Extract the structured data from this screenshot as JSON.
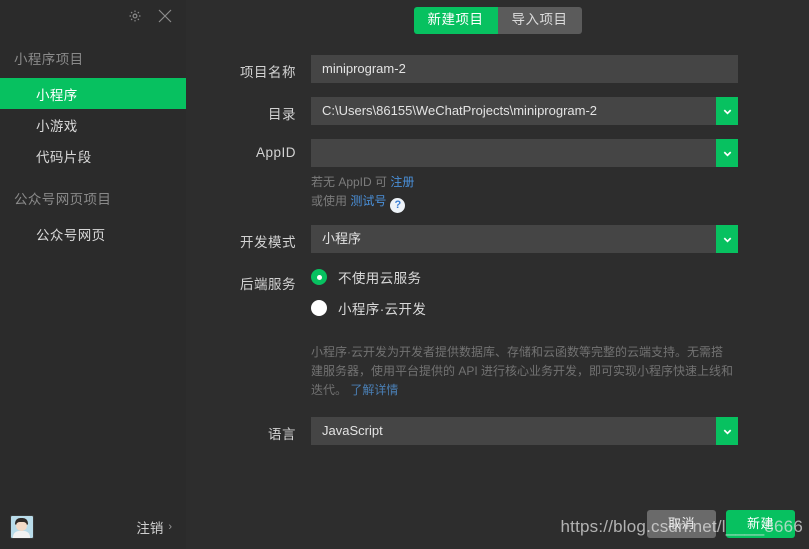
{
  "window": {
    "settings_icon": "gear-icon",
    "close_icon": "close-icon"
  },
  "sidebar": {
    "groups": [
      {
        "title": "小程序项目",
        "items": [
          {
            "label": "小程序",
            "active": true
          },
          {
            "label": "小游戏",
            "active": false
          },
          {
            "label": "代码片段",
            "active": false
          }
        ]
      },
      {
        "title": "公众号网页项目",
        "items": [
          {
            "label": "公众号网页",
            "active": false
          }
        ]
      }
    ],
    "footer": {
      "avatar_icon": "user-avatar",
      "logout_label": "注销",
      "logout_chevron": "›"
    }
  },
  "tabs": [
    {
      "label": "新建项目",
      "selected": true
    },
    {
      "label": "导入项目",
      "selected": false
    }
  ],
  "form": {
    "project_name": {
      "label": "项目名称",
      "value": "miniprogram-2"
    },
    "directory": {
      "label": "目录",
      "value": "C:\\Users\\86155\\WeChatProjects\\miniprogram-2"
    },
    "appid": {
      "label": "AppID",
      "value": ""
    },
    "appid_hint": {
      "line1_prefix": "若无 AppID 可 ",
      "line1_link": "注册",
      "line2_prefix": "或使用 ",
      "line2_link": "测试号",
      "help_icon": "?"
    },
    "dev_mode": {
      "label": "开发模式",
      "value": "小程序"
    },
    "backend": {
      "label": "后端服务",
      "options": [
        {
          "label": "不使用云服务",
          "selected": true
        },
        {
          "label": "小程序·云开发",
          "selected": false
        }
      ],
      "description": "小程序·云开发为开发者提供数据库、存储和云函数等完整的云端支持。无需搭建服务器，使用平台提供的 API 进行核心业务开发，即可实现小程序快速上线和迭代。",
      "description_link": "了解详情"
    },
    "language": {
      "label": "语言",
      "value": "JavaScript"
    }
  },
  "footer": {
    "cancel_label": "取消",
    "create_label": "新建"
  },
  "watermark": "https://blog.csdn.net/l____8666",
  "colors": {
    "accent": "#07c160",
    "sidebar_bg": "#2b2b2b",
    "main_bg": "#2d2d2d",
    "input_bg": "#454545",
    "link": "#4a90d9"
  }
}
